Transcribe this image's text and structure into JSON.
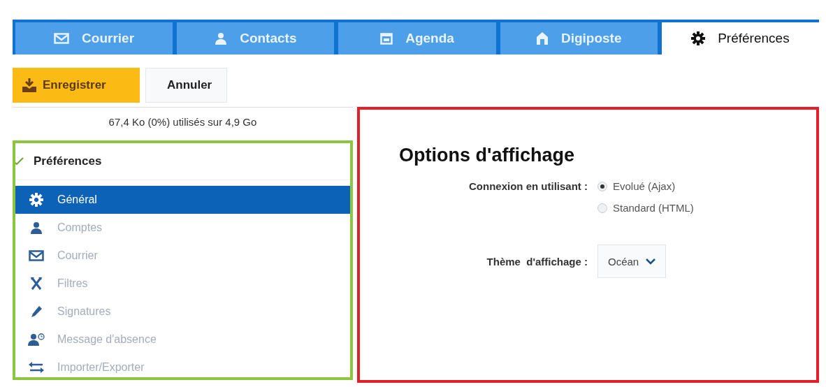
{
  "tabs": [
    {
      "label": "Courrier",
      "selected": false
    },
    {
      "label": "Contacts",
      "selected": false
    },
    {
      "label": "Agenda",
      "selected": false
    },
    {
      "label": "Digiposte",
      "selected": false
    },
    {
      "label": "Préférences",
      "selected": true
    }
  ],
  "toolbar": [
    {
      "kind": "save",
      "label": "Enregistrer"
    },
    {
      "kind": "cancel",
      "label": "Annuler"
    }
  ],
  "quota": "67,4 Ko (0%) utilisés sur 4,9 Go",
  "sidebar": {
    "title": "Préférences",
    "expanded": true,
    "items": [
      {
        "label": "Général",
        "selected": true
      },
      {
        "label": "Comptes",
        "selected": false
      },
      {
        "label": "Courrier",
        "selected": false
      },
      {
        "label": "Filtres",
        "selected": false
      },
      {
        "label": "Signatures",
        "selected": false
      },
      {
        "label": "Message d'absence",
        "selected": false
      },
      {
        "label": "Importer/Exporter",
        "selected": false
      }
    ]
  },
  "options": {
    "title": "Options d'affichage",
    "fields": [
      {
        "kind": "radio",
        "label": "Connexion en utilisant :",
        "options": [
          {
            "label": "Evolué (Ajax)",
            "selected": true
          },
          {
            "label": "Standard (HTML)",
            "selected": false
          }
        ]
      },
      {
        "kind": "select",
        "label": "Thème  d'affichage :",
        "value": "Océan"
      }
    ]
  }
}
